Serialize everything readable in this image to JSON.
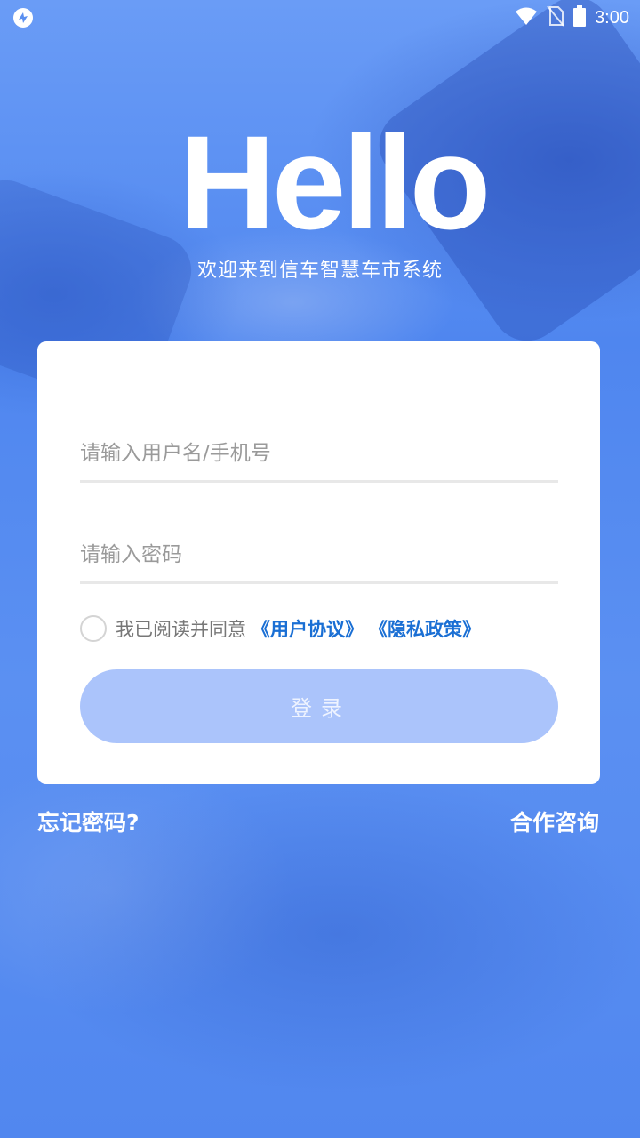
{
  "status_bar": {
    "time": "3:00",
    "icons": [
      "app-logo-icon",
      "wifi-icon",
      "no-sim-icon",
      "battery-icon"
    ]
  },
  "hero": {
    "title": "Hello",
    "subtitle": "欢迎来到信车智慧车市系统"
  },
  "login_form": {
    "username_placeholder": "请输入用户名/手机号",
    "username_value": "",
    "password_placeholder": "请输入密码",
    "password_value": "",
    "agree_checked": false,
    "agree_text": "我已阅读并同意",
    "user_agreement_link": "《用户协议》",
    "privacy_policy_link": "《隐私政策》",
    "login_button": "登录"
  },
  "footer_links": {
    "forgot_password": "忘记密码?",
    "cooperation": "合作咨询"
  },
  "colors": {
    "background": "#5a8ff0",
    "card": "#ffffff",
    "link": "#1a6fd4",
    "button": "#abc4fb"
  }
}
